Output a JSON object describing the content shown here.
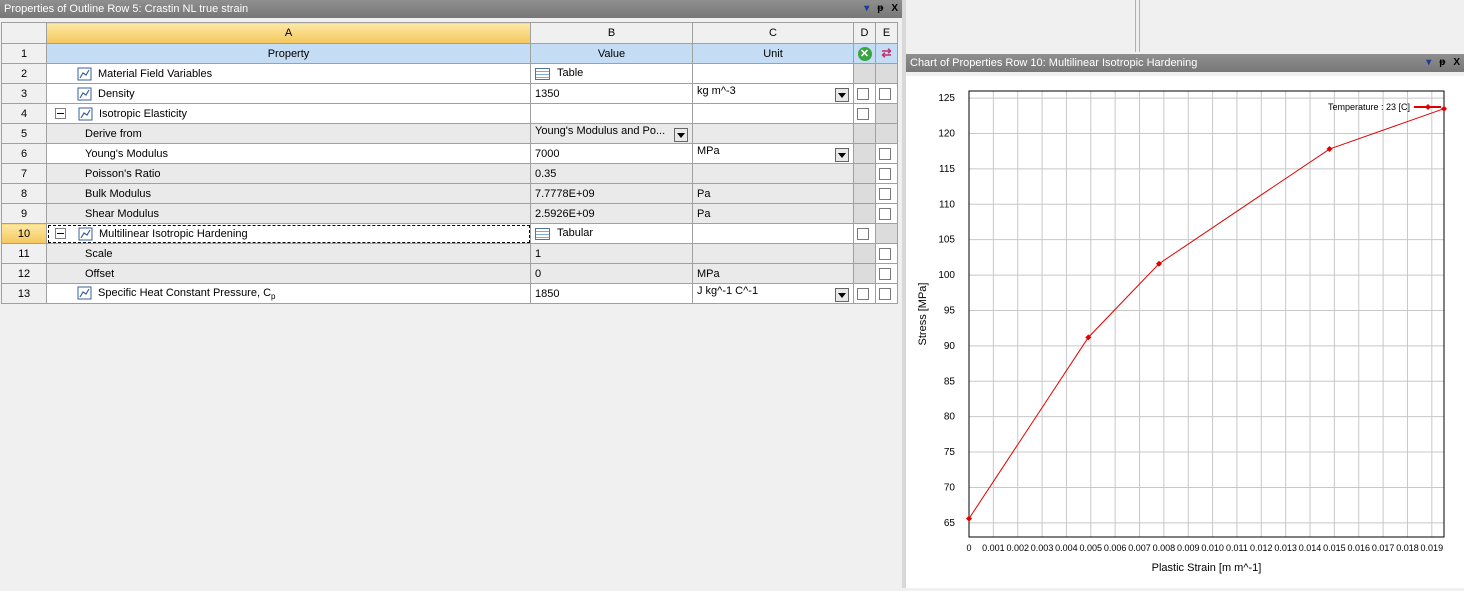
{
  "left_panel": {
    "title": "Properties of Outline Row 5: Crastin NL true strain",
    "ctrl_dropdown": "▾",
    "ctrl_pin": "ᵽ",
    "ctrl_close": "X"
  },
  "table": {
    "col_letters": [
      "A",
      "B",
      "C",
      "D",
      "E"
    ],
    "headers": {
      "row": "1",
      "property": "Property",
      "value": "Value",
      "unit": "Unit"
    },
    "rows": [
      {
        "num": "2",
        "property": "Material Field Variables",
        "value": "Table",
        "unit": ""
      },
      {
        "num": "3",
        "property": "Density",
        "value": "1350",
        "unit": "kg m^-3"
      },
      {
        "num": "4",
        "property": "Isotropic Elasticity",
        "value": "",
        "unit": ""
      },
      {
        "num": "5",
        "property": "Derive from",
        "value": "Young's Modulus and Po...",
        "unit": ""
      },
      {
        "num": "6",
        "property": "Young's Modulus",
        "value": "7000",
        "unit": "MPa"
      },
      {
        "num": "7",
        "property": "Poisson's Ratio",
        "value": "0.35",
        "unit": ""
      },
      {
        "num": "8",
        "property": "Bulk Modulus",
        "value": "7.7778E+09",
        "unit": "Pa"
      },
      {
        "num": "9",
        "property": "Shear Modulus",
        "value": "2.5926E+09",
        "unit": "Pa"
      },
      {
        "num": "10",
        "property": "Multilinear Isotropic Hardening",
        "value": "Tabular",
        "unit": ""
      },
      {
        "num": "11",
        "property": "Scale",
        "value": "1",
        "unit": ""
      },
      {
        "num": "12",
        "property": "Offset",
        "value": "0",
        "unit": "MPa"
      },
      {
        "num": "13",
        "property": "Specific Heat Constant Pressure, C",
        "property_sub": "p",
        "value": "1850",
        "unit": "J kg^-1 C^-1"
      }
    ]
  },
  "right_panel": {
    "title": "Chart of Properties Row 10: Multilinear Isotropic Hardening",
    "ctrl_dropdown": "▾",
    "ctrl_pin": "ᵽ",
    "ctrl_close": "X"
  },
  "chart_data": {
    "type": "line",
    "xlabel": "Plastic Strain  [m m^-1]",
    "ylabel": "Stress  [MPa]",
    "xlim": [
      0,
      0.0195
    ],
    "ylim": [
      63,
      126
    ],
    "xticks": [
      0,
      0.001,
      0.002,
      0.003,
      0.004,
      0.005,
      0.006,
      0.007,
      0.008,
      0.009,
      0.01,
      0.011,
      0.012,
      0.013,
      0.014,
      0.015,
      0.016,
      0.017,
      0.018,
      0.019
    ],
    "xtick_labels": [
      "0",
      "0.001",
      "0.002",
      "0.003",
      "0.004",
      "0.005",
      "0.006",
      "0.007",
      "0.008",
      "0.009",
      "0.010",
      "0.011",
      "0.012",
      "0.013",
      "0.014",
      "0.015",
      "0.016",
      "0.017",
      "0.018",
      "0.019"
    ],
    "yticks": [
      65,
      70,
      75,
      80,
      85,
      90,
      95,
      100,
      105,
      110,
      115,
      120,
      125
    ],
    "grid": true,
    "legend": "top-right",
    "series": [
      {
        "name": "Temperature : 23 [C]",
        "color": "#e00000",
        "x": [
          0,
          0.0049,
          0.0078,
          0.0148,
          0.0195
        ],
        "y": [
          65.6,
          91.2,
          101.6,
          117.8,
          123.5
        ]
      }
    ]
  }
}
